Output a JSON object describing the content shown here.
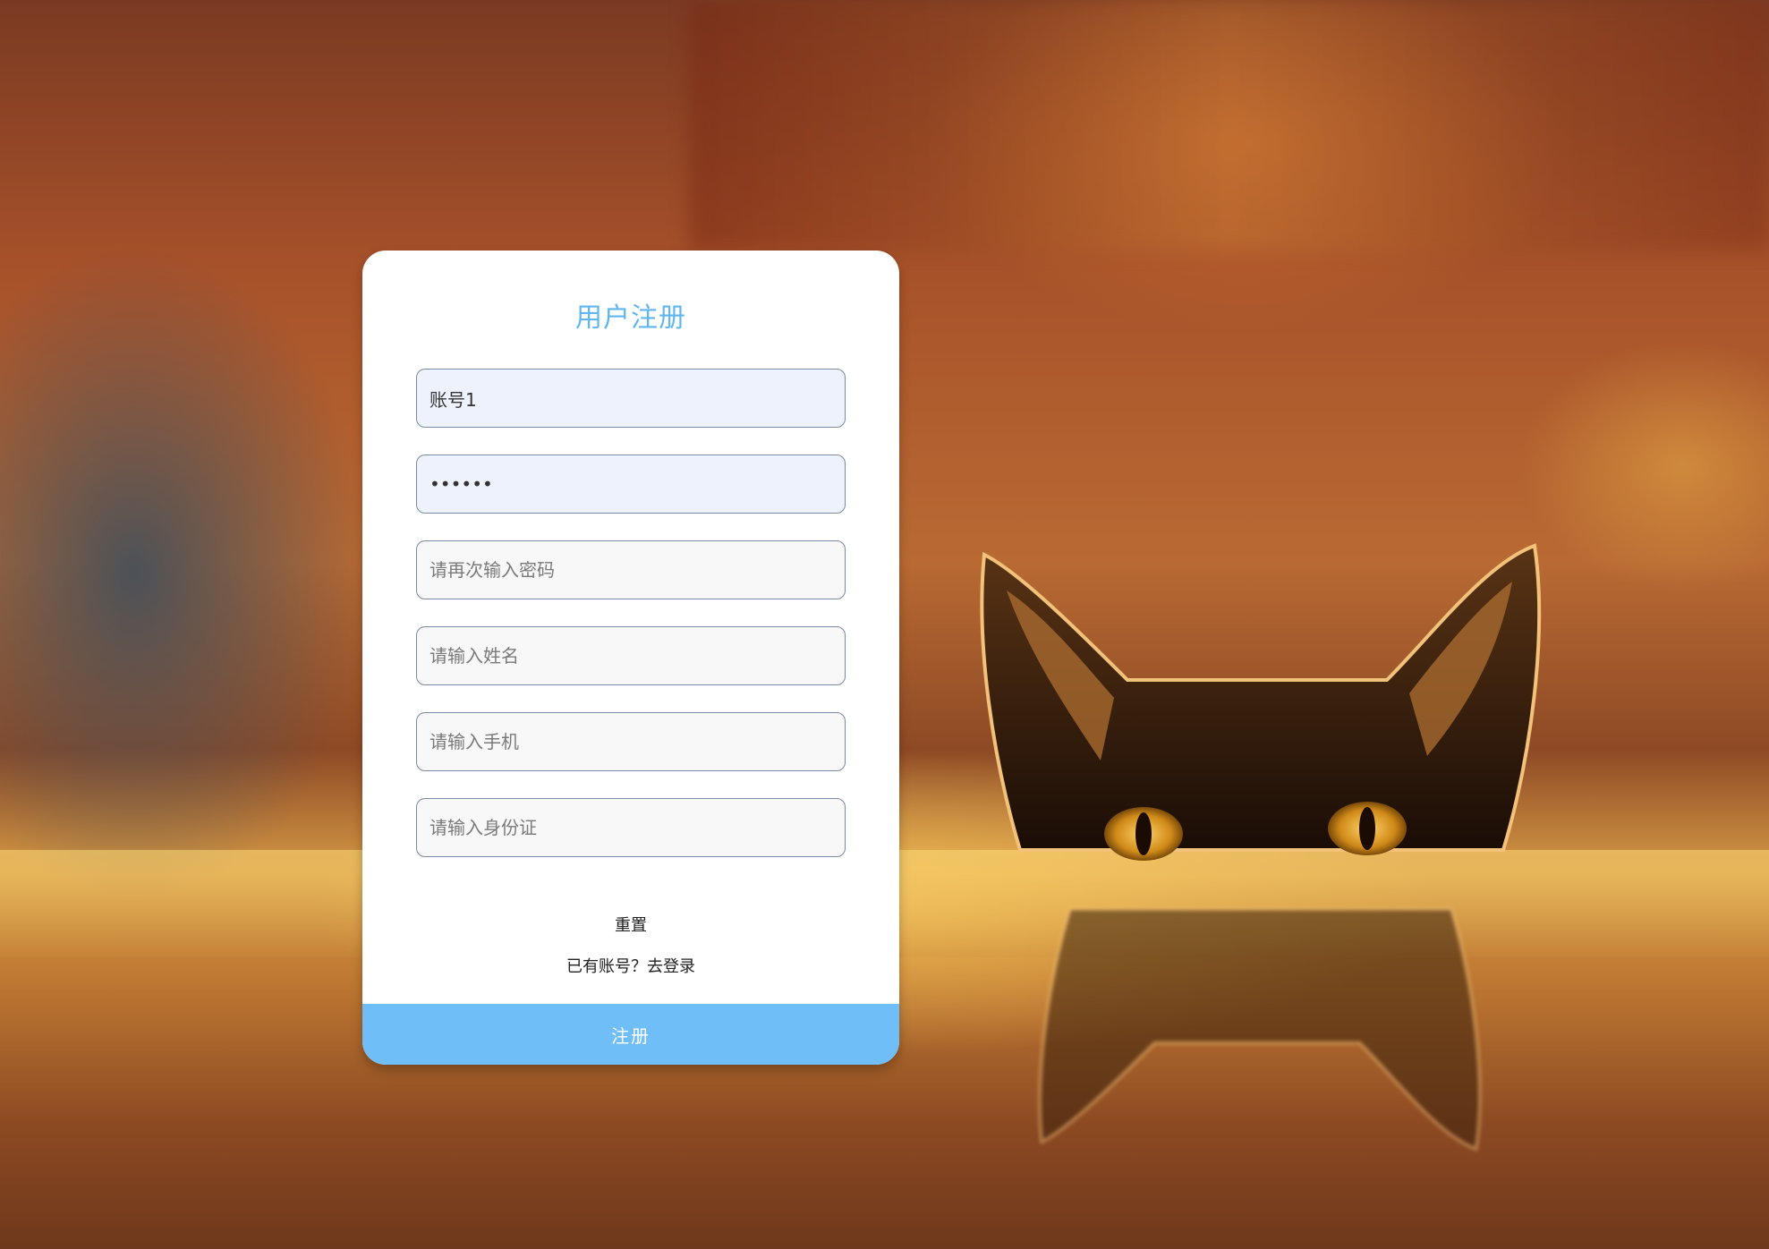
{
  "form": {
    "title": "用户注册",
    "fields": [
      {
        "name": "username",
        "value": "账号1",
        "placeholder": ""
      },
      {
        "name": "password",
        "value": "••••••",
        "placeholder": ""
      },
      {
        "name": "confirm_password",
        "value": "",
        "placeholder": "请再次输入密码"
      },
      {
        "name": "full_name",
        "value": "",
        "placeholder": "请输入姓名"
      },
      {
        "name": "phone",
        "value": "",
        "placeholder": "请输入手机"
      },
      {
        "name": "id_card",
        "value": "",
        "placeholder": "请输入身份证"
      }
    ],
    "reset_label": "重置",
    "login_link_label": "已有账号？去登录",
    "submit_label": "注册"
  },
  "colors": {
    "accent": "#6fbef7",
    "title": "#62b6f0",
    "filled_input_bg": "#edf2fc"
  }
}
